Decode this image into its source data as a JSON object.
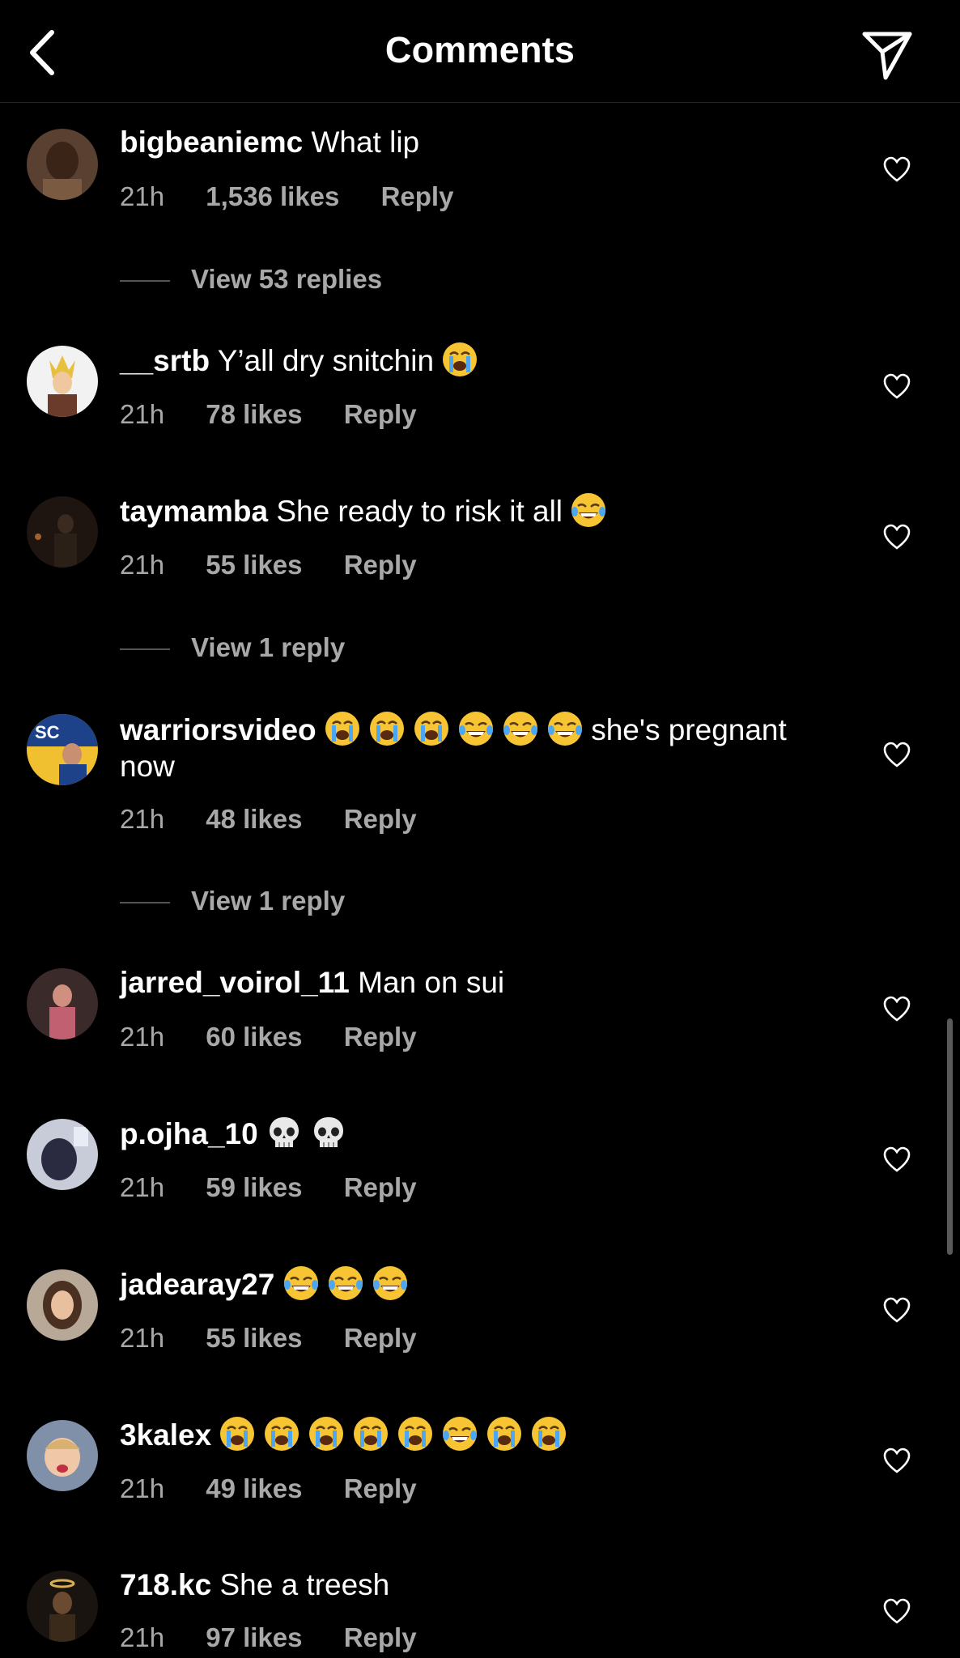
{
  "header": {
    "title": "Comments"
  },
  "comments": [
    {
      "username": "bigbeaniemc",
      "text": "What lip",
      "emojis": [],
      "time": "21h",
      "likes": "1,536 likes",
      "reply": "Reply",
      "view_replies": "View 53 replies"
    },
    {
      "username": "__srtb",
      "text": "Y’all dry snitchin",
      "emojis": [
        "loudly-crying-face"
      ],
      "time": "21h",
      "likes": "78 likes",
      "reply": "Reply"
    },
    {
      "username": "taymamba",
      "text": "She ready to risk it all",
      "emojis": [
        "face-with-tears-of-joy"
      ],
      "time": "21h",
      "likes": "55 likes",
      "reply": "Reply",
      "view_replies": "View 1 reply"
    },
    {
      "username": "warriorsvideo",
      "text_after": "she's pregnant now",
      "emojis": [
        "loudly-crying-face",
        "loudly-crying-face",
        "loudly-crying-face",
        "face-with-tears-of-joy",
        "face-with-tears-of-joy",
        "face-with-tears-of-joy"
      ],
      "time": "21h",
      "likes": "48 likes",
      "reply": "Reply",
      "view_replies": "View 1 reply"
    },
    {
      "username": "jarred_voirol_11",
      "text": "Man on sui",
      "emojis": [],
      "time": "21h",
      "likes": "60 likes",
      "reply": "Reply"
    },
    {
      "username": "p.ojha_10",
      "text": "",
      "emojis": [
        "skull",
        "skull"
      ],
      "time": "21h",
      "likes": "59 likes",
      "reply": "Reply"
    },
    {
      "username": "jadearay27",
      "text": "",
      "emojis": [
        "face-with-tears-of-joy",
        "face-with-tears-of-joy",
        "face-with-tears-of-joy"
      ],
      "time": "21h",
      "likes": "55 likes",
      "reply": "Reply"
    },
    {
      "username": "3kalex",
      "text": "",
      "emojis": [
        "loudly-crying-face",
        "loudly-crying-face",
        "loudly-crying-face",
        "loudly-crying-face",
        "loudly-crying-face",
        "face-with-tears-of-joy",
        "loudly-crying-face",
        "loudly-crying-face"
      ],
      "time": "21h",
      "likes": "49 likes",
      "reply": "Reply"
    },
    {
      "username": "718.kc",
      "text": "She a treesh",
      "emojis": [],
      "time": "21h",
      "likes": "97 likes",
      "reply": "Reply"
    }
  ],
  "icons": {
    "back": "chevron-left-icon",
    "share": "paper-plane-icon",
    "like": "heart-outline-icon"
  },
  "colors": {
    "background": "#000000",
    "text_primary": "#ffffff",
    "text_secondary": "#a8a8a8",
    "emoji_yellow": "#f7c533"
  }
}
